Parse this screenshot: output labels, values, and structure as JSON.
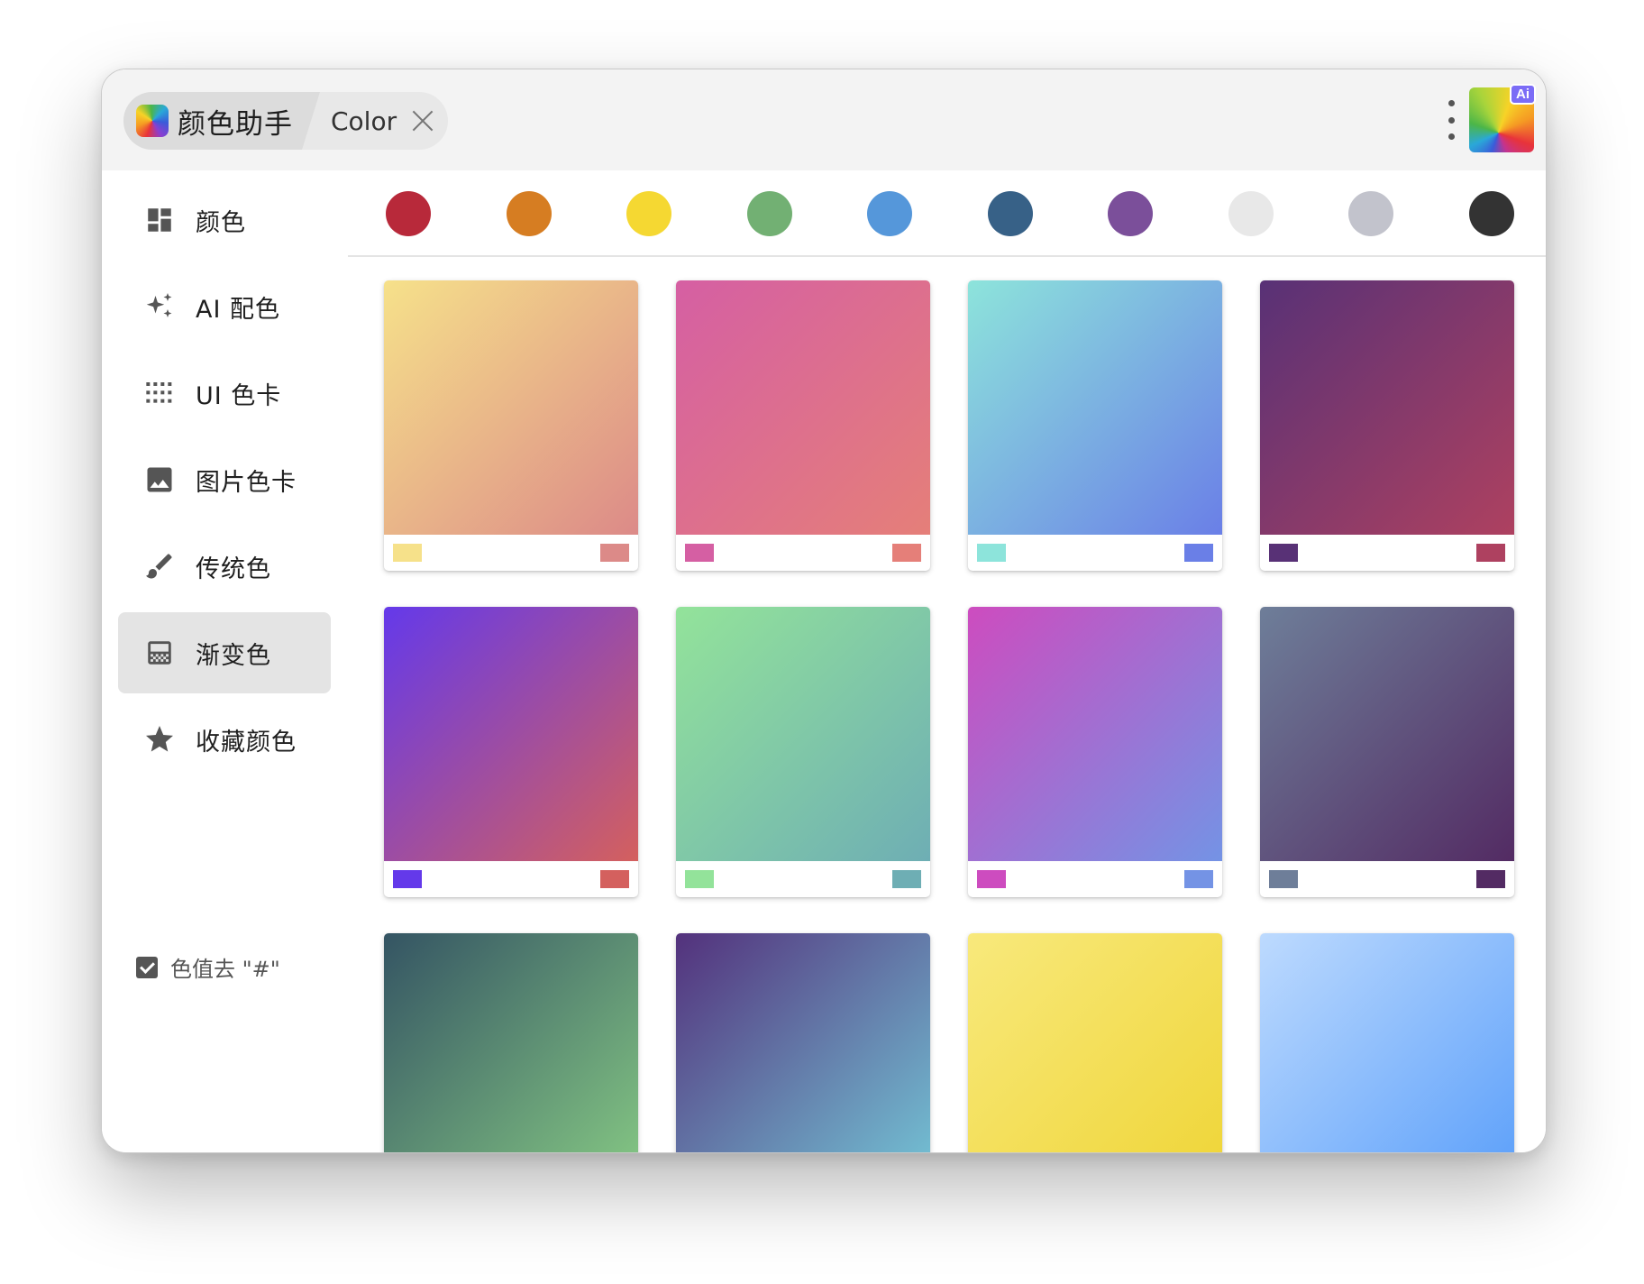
{
  "window": {
    "tab_active_label": "颜色助手",
    "tab_inactive_label": "Color",
    "ai_badge": "Ai"
  },
  "sidebar": {
    "items": [
      {
        "label": "颜色",
        "icon": "dashboard-icon",
        "active": false
      },
      {
        "label": "AI 配色",
        "icon": "sparkle-icon",
        "active": false
      },
      {
        "label": "UI 色卡",
        "icon": "dot-grid-icon",
        "active": false
      },
      {
        "label": "图片色卡",
        "icon": "image-icon",
        "active": false
      },
      {
        "label": "传统色",
        "icon": "brush-icon",
        "active": false
      },
      {
        "label": "渐变色",
        "icon": "gradient-icon",
        "active": true
      },
      {
        "label": "收藏颜色",
        "icon": "star-icon",
        "active": false
      }
    ],
    "hash_option": {
      "label": "色值去 \"#\"",
      "checked": true
    }
  },
  "swatches": [
    "#b8293a",
    "#d67d22",
    "#f5d832",
    "#72b073",
    "#5597da",
    "#376187",
    "#7b4f9a",
    "#e8e8e8",
    "#c2c3cc",
    "#333333"
  ],
  "gradients": [
    {
      "from": "#f6e18a",
      "to": "#dc8a88"
    },
    {
      "from": "#d55fa3",
      "to": "#e57f79"
    },
    {
      "from": "#8de4db",
      "to": "#6a7fe7"
    },
    {
      "from": "#583176",
      "to": "#ae4160"
    },
    {
      "from": "#6439ea",
      "to": "#d4605e"
    },
    {
      "from": "#93e39a",
      "to": "#6eaeb4"
    },
    {
      "from": "#cd4cbf",
      "to": "#7493e5"
    },
    {
      "from": "#6e7e99",
      "to": "#532b63"
    },
    {
      "from": "#345463",
      "to": "#86c984"
    },
    {
      "from": "#53317c",
      "to": "#74c5d6"
    },
    {
      "from": "#f8e97c",
      "to": "#efd537"
    },
    {
      "from": "#bddafe",
      "to": "#5b9ffa"
    }
  ]
}
